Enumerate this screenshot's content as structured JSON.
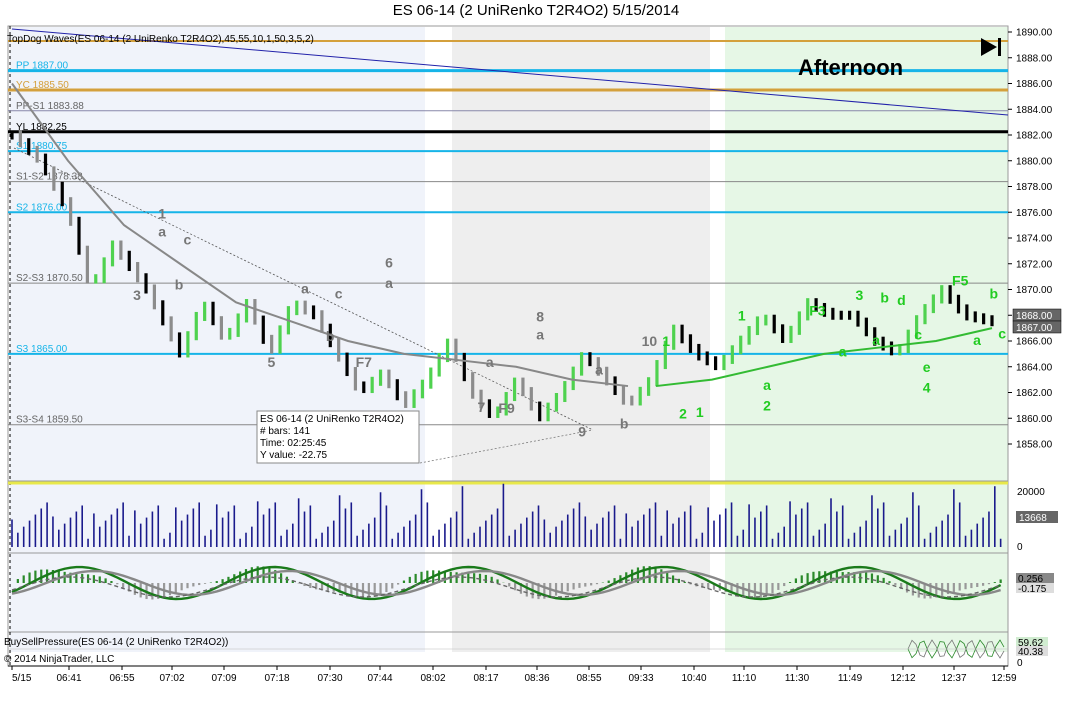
{
  "window": {
    "title": "ES 06-14 (2 UniRenko T2R4O2)  5/15/2014"
  },
  "indicators": {
    "waves": "TopDog Waves(ES 06-14 (2 UniRenko T2R4O2),45,55,10,1,50,3,5,2)",
    "pressure": "BuySellPressure(ES 06-14 (2 UniRenko T2R4O2))",
    "copyright": "© 2014 NinjaTrader, LLC"
  },
  "session_label": "Afternoon",
  "info_box": {
    "line1": "ES 06-14 (2 UniRenko T2R4O2)",
    "line2": "# bars:   141",
    "line3": "Time:     02:25:45",
    "line4": "Y value:  -22.75"
  },
  "colors": {
    "up_bar": "#4fd24f",
    "down_bar": "#000000",
    "neutral_bar": "#8c8c8c",
    "volume": "#1a1a8c",
    "level_cyan": "#16b4e8",
    "level_gold": "#d4a03c",
    "afternoon_bg": "#e6f7e6",
    "gray_bg": "#eeeeee",
    "blue_bg": "#f0f3fa",
    "ma_gray": "#888888",
    "ma_green": "#33bb33"
  },
  "chart_data": [
    {
      "type": "line",
      "name": "price",
      "ylim": [
        1856,
        1890
      ],
      "y_ticks": [
        1858,
        1860,
        1862,
        1864,
        1866,
        1868,
        1870,
        1872,
        1874,
        1876,
        1878,
        1880,
        1882,
        1884,
        1886,
        1888,
        1890
      ],
      "y_tick_labels": [
        "1858.00",
        "1860.00",
        "1862.00",
        "1864.00",
        "1866.00",
        "1868.00",
        "1870.00",
        "1872.00",
        "1874.00",
        "1876.00",
        "1878.00",
        "1880.00",
        "1882.00",
        "1884.00",
        "1886.00",
        "1888.00",
        "1890.00"
      ],
      "x_tick_labels": [
        "5/15",
        "06:41",
        "06:55",
        "07:02",
        "07:09",
        "07:18",
        "07:30",
        "07:44",
        "08:02",
        "08:17",
        "08:36",
        "08:55",
        "09:33",
        "10:40",
        "11:10",
        "11:30",
        "11:49",
        "12:12",
        "12:37",
        "12:59"
      ],
      "price_path": [
        [
          0,
          1882
        ],
        [
          5,
          1880
        ],
        [
          10,
          1876
        ],
        [
          14,
          1870
        ],
        [
          18,
          1873.5
        ],
        [
          24,
          1870
        ],
        [
          30,
          1865
        ],
        [
          34,
          1869
        ],
        [
          38,
          1866
        ],
        [
          42,
          1869
        ],
        [
          46,
          1865
        ],
        [
          50,
          1869
        ],
        [
          54,
          1868
        ],
        [
          58,
          1865
        ],
        [
          62,
          1862
        ],
        [
          66,
          1863.5
        ],
        [
          70,
          1861
        ],
        [
          74,
          1863
        ],
        [
          78,
          1866
        ],
        [
          82,
          1862
        ],
        [
          86,
          1860
        ],
        [
          90,
          1863
        ],
        [
          94,
          1860
        ],
        [
          98,
          1862
        ],
        [
          102,
          1865
        ],
        [
          106,
          1863
        ],
        [
          110,
          1861
        ],
        [
          114,
          1863
        ],
        [
          118,
          1867
        ],
        [
          122,
          1865
        ],
        [
          126,
          1864
        ],
        [
          130,
          1866
        ],
        [
          134,
          1868
        ],
        [
          138,
          1866
        ],
        [
          142,
          1869
        ],
        [
          146,
          1868
        ],
        [
          150,
          1868
        ],
        [
          154,
          1866
        ],
        [
          158,
          1865
        ],
        [
          162,
          1868
        ],
        [
          166,
          1870
        ],
        [
          170,
          1868
        ],
        [
          175,
          1867.5
        ]
      ],
      "ma_gray": [
        [
          0,
          1886
        ],
        [
          10,
          1880
        ],
        [
          20,
          1875
        ],
        [
          30,
          1872
        ],
        [
          40,
          1869
        ],
        [
          50,
          1867.5
        ],
        [
          60,
          1866
        ],
        [
          70,
          1865
        ],
        [
          80,
          1864.5
        ],
        [
          90,
          1864
        ],
        [
          100,
          1863
        ],
        [
          110,
          1862.5
        ]
      ],
      "ma_green": [
        [
          115,
          1862.5
        ],
        [
          125,
          1863
        ],
        [
          135,
          1864
        ],
        [
          145,
          1865
        ],
        [
          155,
          1865.5
        ],
        [
          165,
          1866
        ],
        [
          175,
          1867
        ]
      ],
      "levels": [
        {
          "label": "PP 1887.00",
          "value": 1887.0,
          "color": "#16b4e8",
          "width": 3
        },
        {
          "label": "YC 1885.50",
          "value": 1885.5,
          "color": "#d4a03c",
          "width": 3
        },
        {
          "label": "PP-S1 1883.88",
          "value": 1883.88,
          "color": "#8888aa",
          "width": 1
        },
        {
          "label": "YL 1882.25",
          "value": 1882.25,
          "color": "#000000",
          "width": 3
        },
        {
          "label": "S1 1880.75",
          "value": 1880.75,
          "color": "#16b4e8",
          "width": 2
        },
        {
          "label": "S1-S2 1878.38",
          "value": 1878.38,
          "color": "#888888",
          "width": 1
        },
        {
          "label": "S2 1876.00",
          "value": 1876.0,
          "color": "#16b4e8",
          "width": 2
        },
        {
          "label": "S2-S3 1870.50",
          "value": 1870.5,
          "color": "#888888",
          "width": 1
        },
        {
          "label": "S3 1865.00",
          "value": 1865.0,
          "color": "#16b4e8",
          "width": 2
        },
        {
          "label": "S3-S4 1859.50",
          "value": 1859.5,
          "color": "#888888",
          "width": 1
        }
      ],
      "current_price_labels": [
        "1868.00",
        "1867.00"
      ],
      "wave_labels": [
        {
          "t": "1",
          "i": 18,
          "y": 1875.5,
          "c": "g"
        },
        {
          "t": "a",
          "i": 18,
          "y": 1874.1,
          "c": "g"
        },
        {
          "t": "c",
          "i": 21,
          "y": 1873.5,
          "c": "g"
        },
        {
          "t": "3",
          "i": 15,
          "y": 1869.2,
          "c": "g"
        },
        {
          "t": "b",
          "i": 20,
          "y": 1870,
          "c": "g"
        },
        {
          "t": "5",
          "i": 31,
          "y": 1864,
          "c": "g"
        },
        {
          "t": "a",
          "i": 35,
          "y": 1869.7,
          "c": "g"
        },
        {
          "t": "c",
          "i": 39,
          "y": 1869.3,
          "c": "g"
        },
        {
          "t": "b",
          "i": 38,
          "y": 1866,
          "c": "g"
        },
        {
          "t": "F7",
          "i": 42,
          "y": 1864,
          "c": "g"
        },
        {
          "t": "6",
          "i": 45,
          "y": 1871.7,
          "c": "g"
        },
        {
          "t": "a",
          "i": 45,
          "y": 1870.1,
          "c": "g"
        },
        {
          "t": "8",
          "i": 63,
          "y": 1867.5,
          "c": "g"
        },
        {
          "t": "a",
          "i": 63,
          "y": 1866.1,
          "c": "g"
        },
        {
          "t": "a",
          "i": 57,
          "y": 1864,
          "c": "g"
        },
        {
          "t": "7",
          "i": 56,
          "y": 1860.5,
          "c": "g"
        },
        {
          "t": "F9",
          "i": 59,
          "y": 1860.4,
          "c": "g"
        },
        {
          "t": "a",
          "i": 70,
          "y": 1863.4,
          "c": "g"
        },
        {
          "t": "9",
          "i": 68,
          "y": 1858.6,
          "c": "g"
        },
        {
          "t": "b",
          "i": 73,
          "y": 1859.2,
          "c": "g"
        },
        {
          "t": "10",
          "i": 76,
          "y": 1865.6,
          "c": "g"
        },
        {
          "t": "1",
          "i": 78,
          "y": 1865.6,
          "c": "G"
        },
        {
          "t": "2",
          "i": 80,
          "y": 1860,
          "c": "G"
        },
        {
          "t": "1",
          "i": 82,
          "y": 1860.1,
          "c": "G"
        },
        {
          "t": "1",
          "i": 87,
          "y": 1867.6,
          "c": "G"
        },
        {
          "t": "a",
          "i": 90,
          "y": 1862.2,
          "c": "G"
        },
        {
          "t": "2",
          "i": 90,
          "y": 1860.6,
          "c": "G"
        },
        {
          "t": "F3",
          "i": 96,
          "y": 1868,
          "c": "G"
        },
        {
          "t": "a",
          "i": 99,
          "y": 1864.8,
          "c": "G"
        },
        {
          "t": "3",
          "i": 101,
          "y": 1869.2,
          "c": "G"
        },
        {
          "t": "b",
          "i": 104,
          "y": 1869,
          "c": "G"
        },
        {
          "t": "d",
          "i": 106,
          "y": 1868.8,
          "c": "G"
        },
        {
          "t": "a",
          "i": 103,
          "y": 1865.7,
          "c": "G"
        },
        {
          "t": "c",
          "i": 108,
          "y": 1866.1,
          "c": "G"
        },
        {
          "t": "e",
          "i": 109,
          "y": 1863.6,
          "c": "G"
        },
        {
          "t": "4",
          "i": 109,
          "y": 1862,
          "c": "G"
        },
        {
          "t": "F5",
          "i": 113,
          "y": 1870.3,
          "c": "G"
        },
        {
          "t": "b",
          "i": 117,
          "y": 1869.3,
          "c": "G"
        },
        {
          "t": "a",
          "i": 115,
          "y": 1865.7,
          "c": "G"
        },
        {
          "t": "c",
          "i": 118,
          "y": 1866.2,
          "c": "G"
        }
      ]
    },
    {
      "type": "bar",
      "name": "volume",
      "ylim": [
        0,
        24000
      ],
      "y_tick_labels": [
        "20000",
        "0"
      ],
      "last_value_label": "13668"
    },
    {
      "type": "line",
      "name": "oscillator",
      "last_value_labels": [
        "0.256",
        "-0.175"
      ]
    },
    {
      "type": "line",
      "name": "buy_sell_pressure",
      "last_value_labels": [
        "59.62",
        "40.38"
      ],
      "y_tick_labels": [
        "0"
      ]
    }
  ]
}
